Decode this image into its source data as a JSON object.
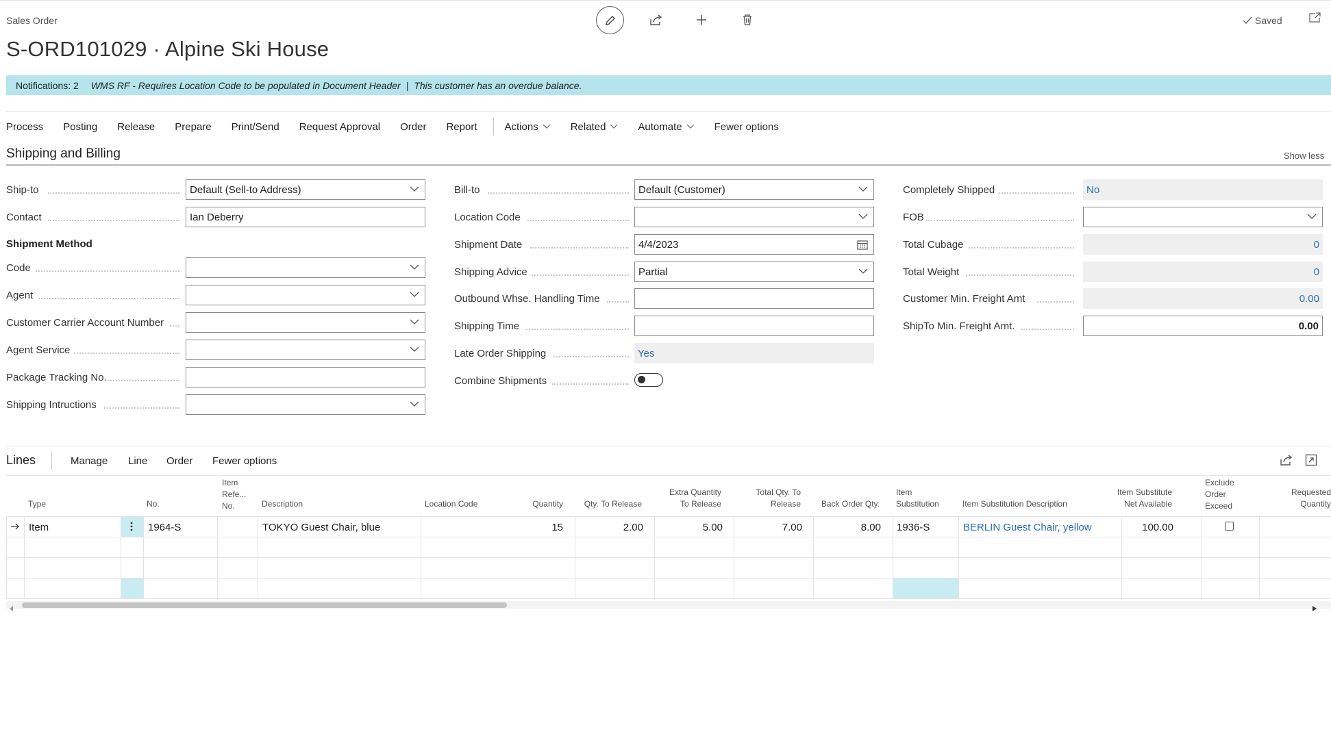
{
  "header": {
    "page_type": "Sales Order",
    "title": "S-ORD101029 · Alpine Ski House",
    "saved_label": "Saved"
  },
  "icons": {
    "edit": "pencil-icon",
    "share": "share-icon",
    "new": "plus-icon",
    "delete": "trash-icon",
    "saved": "check-icon",
    "popout": "popout-icon"
  },
  "notifications": {
    "count_label": "Notifications: 2",
    "message1": "WMS RF - Requires Location Code to be populated in Document Header",
    "separator": "|",
    "message2": "This customer has an overdue balance."
  },
  "actions": {
    "items": [
      "Process",
      "Posting",
      "Release",
      "Prepare",
      "Print/Send",
      "Request Approval",
      "Order",
      "Report"
    ],
    "dropdowns": [
      "Actions",
      "Related",
      "Automate"
    ],
    "fewer_options": "Fewer options"
  },
  "section": {
    "title": "Shipping and Billing",
    "show_less": "Show less"
  },
  "col1": {
    "ship_to_label": "Ship-to",
    "ship_to_value": "Default (Sell-to Address)",
    "contact_label": "Contact",
    "contact_value": "Ian Deberry",
    "shipment_method_heading": "Shipment Method",
    "code_label": "Code",
    "code_value": "",
    "agent_label": "Agent",
    "agent_value": "",
    "carrier_label": "Customer Carrier Account Number",
    "carrier_value": "",
    "agent_service_label": "Agent Service",
    "agent_service_value": "",
    "tracking_label": "Package Tracking No.",
    "tracking_value": "",
    "instructions_label": "Shipping Intructions",
    "instructions_value": ""
  },
  "col2": {
    "bill_to_label": "Bill-to",
    "bill_to_value": "Default (Customer)",
    "location_label": "Location Code",
    "location_value": "",
    "shipment_date_label": "Shipment Date",
    "shipment_date_value": "4/4/2023",
    "shipping_advice_label": "Shipping Advice",
    "shipping_advice_value": "Partial",
    "outbound_label": "Outbound Whse. Handling Time",
    "outbound_value": "",
    "shipping_time_label": "Shipping Time",
    "shipping_time_value": "",
    "late_label": "Late Order Shipping",
    "late_value": "Yes",
    "combine_label": "Combine Shipments",
    "combine_value": false
  },
  "col3": {
    "completely_label": "Completely Shipped",
    "completely_value": "No",
    "fob_label": "FOB",
    "fob_value": "",
    "cubage_label": "Total Cubage",
    "cubage_value": "0",
    "weight_label": "Total Weight",
    "weight_value": "0",
    "cust_freight_label": "Customer Min. Freight Amt",
    "cust_freight_value": "0.00",
    "shipto_freight_label": "ShipTo Min. Freight Amt.",
    "shipto_freight_value": "0.00"
  },
  "lines": {
    "title": "Lines",
    "actions": [
      "Manage",
      "Line",
      "Order",
      "Fewer options"
    ],
    "headers": {
      "type": "Type",
      "no": "No.",
      "item_ref": [
        "Item",
        "Refe...",
        "No."
      ],
      "description": "Description",
      "location": "Location Code",
      "quantity": "Quantity",
      "qty_release": "Qty. To Release",
      "extra": [
        "Extra Quantity",
        "To Release"
      ],
      "total": [
        "Total Qty. To",
        "Release"
      ],
      "back": "Back Order Qty.",
      "item_sub": [
        "Item",
        "Substitution"
      ],
      "sub_desc": "Item Substitution Description",
      "sub_net": [
        "Item Substitute",
        "Net Available"
      ],
      "exclude": [
        "Exclude",
        "Order",
        "Exceed"
      ],
      "requested": [
        "Requested",
        "Quantity"
      ]
    },
    "row": {
      "type": "Item",
      "no": "1964-S",
      "description": "TOKYO Guest Chair, blue",
      "quantity": "15",
      "qty_release": "2.00",
      "extra": "5.00",
      "total": "7.00",
      "back": "8.00",
      "item_sub": "1936-S",
      "sub_desc": "BERLIN Guest Chair, yellow",
      "sub_net": "100.00"
    }
  }
}
